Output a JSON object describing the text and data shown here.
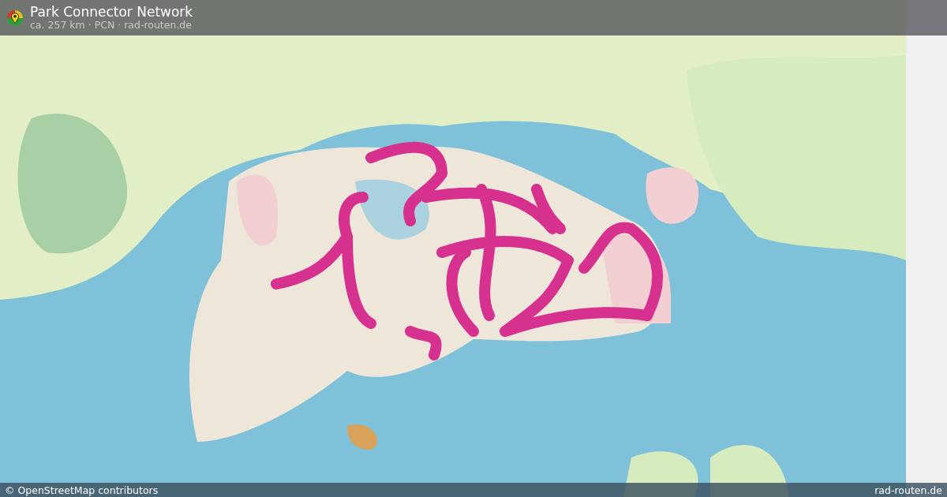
{
  "header": {
    "title": "Park Connector Network",
    "subtitle": "ca. 257 km · PCN · rad-routen.de"
  },
  "footer": {
    "attribution": "© OpenStreetMap contributors",
    "site": "rad-routen.de"
  }
}
